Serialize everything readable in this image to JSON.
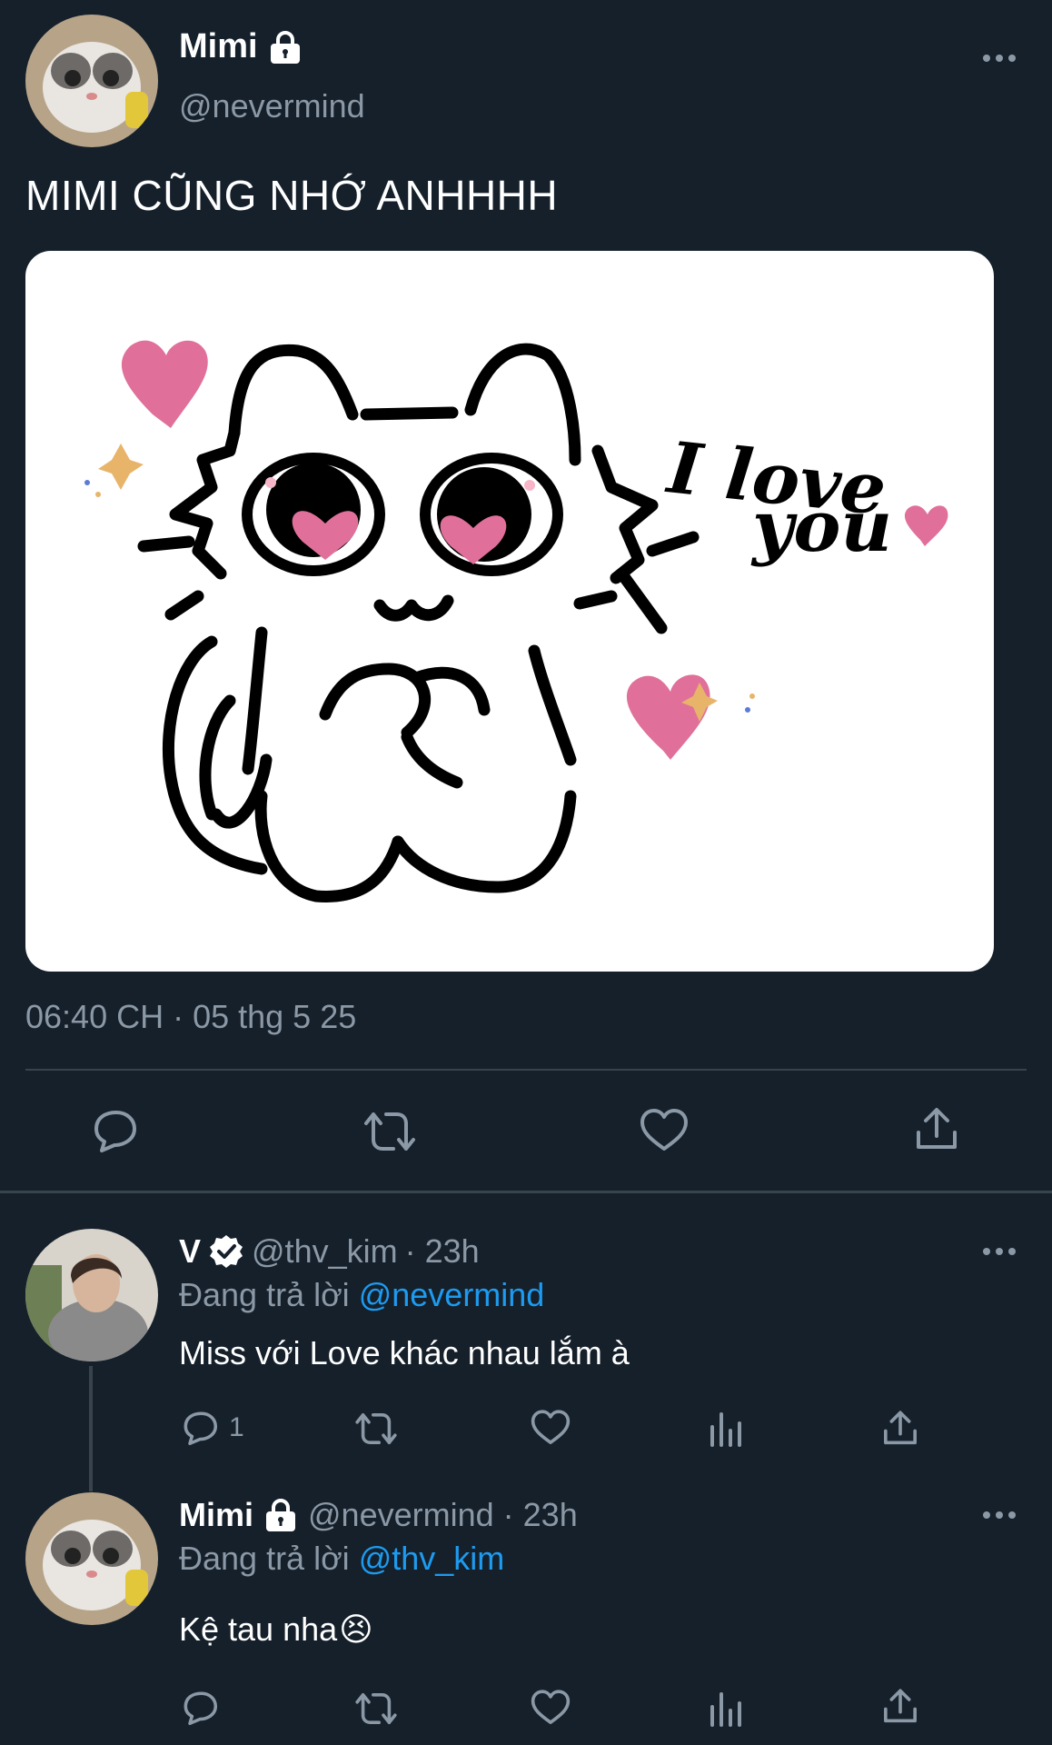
{
  "main_tweet": {
    "display_name": "Mimi",
    "handle": "@nevermind",
    "text": "MIMI CŨNG NHỚ ANHHHH",
    "image": {
      "line1": "I love",
      "line2": "you"
    },
    "timestamp": "06:40 CH · 05 thg 5 25"
  },
  "replies": [
    {
      "display_name": "V",
      "handle": "@thv_kim",
      "time": "· 23h",
      "replying_prefix": "Đang trả lời",
      "replying_to": "@nevermind",
      "text": "Miss với Love khác nhau lắm à",
      "reply_count": "1"
    },
    {
      "display_name": "Mimi",
      "handle": "@nevermind",
      "time": "· 23h",
      "replying_prefix": "Đang trả lời",
      "replying_to": "@thv_kim",
      "text": "Kệ tau nha",
      "emoji": "😣"
    }
  ],
  "colors": {
    "background": "#15202b",
    "muted": "#8b98a5",
    "link": "#1d9bf0",
    "divider": "#38444d",
    "heart_pink": "#e0709a"
  }
}
